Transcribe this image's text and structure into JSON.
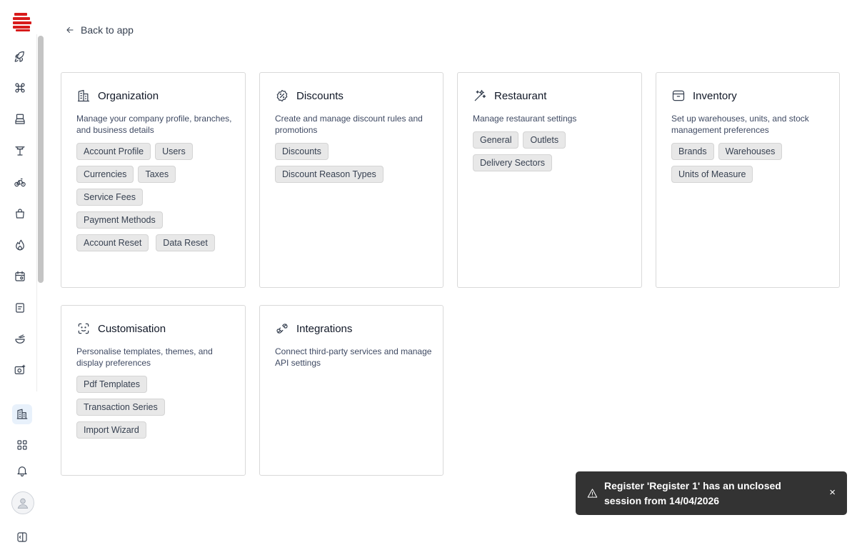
{
  "brand": {
    "accent": "#d81b1b"
  },
  "nav": {
    "back_label": "Back to app",
    "sidebar_icons": [
      "rocket-icon",
      "command-icon",
      "cash-register-icon",
      "table-icon",
      "bicycle-icon",
      "shopping-bag-icon",
      "flame-icon",
      "calendar-settings-icon",
      "receipt-icon",
      "food-bowl-icon",
      "camera-plus-icon"
    ],
    "bottom_icons": [
      "building-icon",
      "grid-icon",
      "bell-icon",
      "user-avatar-icon",
      "sidebar-toggle-icon"
    ]
  },
  "cards": [
    {
      "title": "Organization",
      "icon": "building-icon",
      "description": "Manage your company profile, branches, and business details",
      "tags": [
        "Account Profile",
        "Users",
        "Currencies",
        "Taxes",
        "Service Fees",
        "Payment Methods",
        "Account Reset",
        "Data Reset"
      ]
    },
    {
      "title": "Discounts",
      "icon": "discount-badge-icon",
      "description": "Create and manage discount rules and promotions",
      "tags": [
        "Discounts",
        "Discount Reason Types"
      ]
    },
    {
      "title": "Restaurant",
      "icon": "sparkles-icon",
      "description": "Manage restaurant settings",
      "tags": [
        "General",
        "Outlets",
        "Delivery Sectors"
      ]
    },
    {
      "title": "Inventory",
      "icon": "archive-box-icon",
      "description": "Set up warehouses, units, and stock management preferences",
      "tags": [
        "Brands",
        "Warehouses",
        "Units of Measure"
      ]
    },
    {
      "title": "Customisation",
      "icon": "scan-face-icon",
      "description": "Personalise templates, themes, and display preferences",
      "tags": [
        "Pdf Templates",
        "Transaction Series",
        "Import Wizard"
      ]
    },
    {
      "title": "Integrations",
      "icon": "plug-icon",
      "description": "Connect third-party services and manage API settings",
      "tags": []
    }
  ],
  "toast": {
    "message": "Register 'Register 1' has an unclosed session from 14/04/2026",
    "close_label": "×"
  }
}
